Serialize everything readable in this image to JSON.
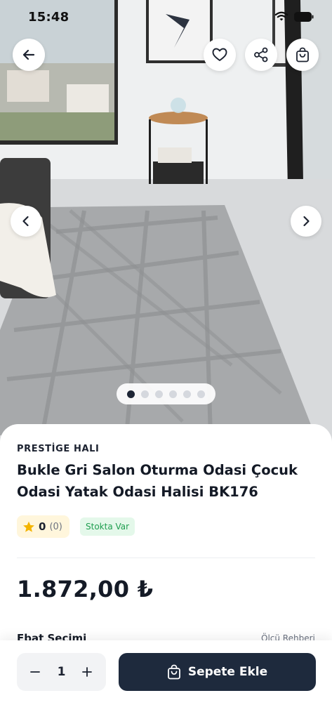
{
  "status_bar": {
    "time": "15:48"
  },
  "icons": {
    "back": "arrow-left-icon",
    "favorite": "heart-icon",
    "share": "share-icon",
    "cart": "shopping-bag-icon",
    "prev": "chevron-left-icon",
    "next": "chevron-right-icon",
    "star": "star-icon",
    "minus": "minus-icon",
    "plus": "plus-icon"
  },
  "gallery": {
    "image_count": 6,
    "active_index": 0
  },
  "product": {
    "brand": "PRESTİGE HALI",
    "title": "Bukle Gri Salon Oturma Odasi Çocuk Odasi Yatak Odasi Halisi BK176",
    "rating_value": "0",
    "rating_count": "(0)",
    "stock_status": "Stokta Var",
    "price": "1.872,00 ₺"
  },
  "next_section": {
    "left_text": "Ebat Seçimi",
    "right_text": "Ölçü Rehberi"
  },
  "cart": {
    "quantity": "1",
    "add_label": "Sepete Ekle"
  },
  "colors": {
    "primary_dark": "#1e2a3d",
    "stock_green": "#1e9e4f",
    "stock_bg": "#e4f8ea",
    "star": "#f4b400",
    "rating_bg": "#fff6dc"
  }
}
